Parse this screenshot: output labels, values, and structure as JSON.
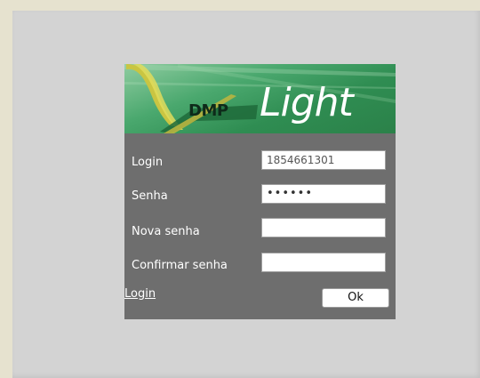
{
  "logo": {
    "brand": "DMP",
    "product": "Light"
  },
  "form": {
    "login_label": "Login",
    "login_value": "1854661301",
    "password_label": "Senha",
    "password_value": "••••••",
    "new_password_label": "Nova senha",
    "new_password_value": "",
    "confirm_password_label": "Confirmar senha",
    "confirm_password_value": ""
  },
  "actions": {
    "login_link": "Login",
    "ok_button": "Ok"
  },
  "colors": {
    "page_bg": "#e6e2cf",
    "panel_bg": "#d3d3d3",
    "box_bg": "#6e6e6e",
    "banner_green": "#2f8d52",
    "logo_yellow": "#c9c542"
  }
}
